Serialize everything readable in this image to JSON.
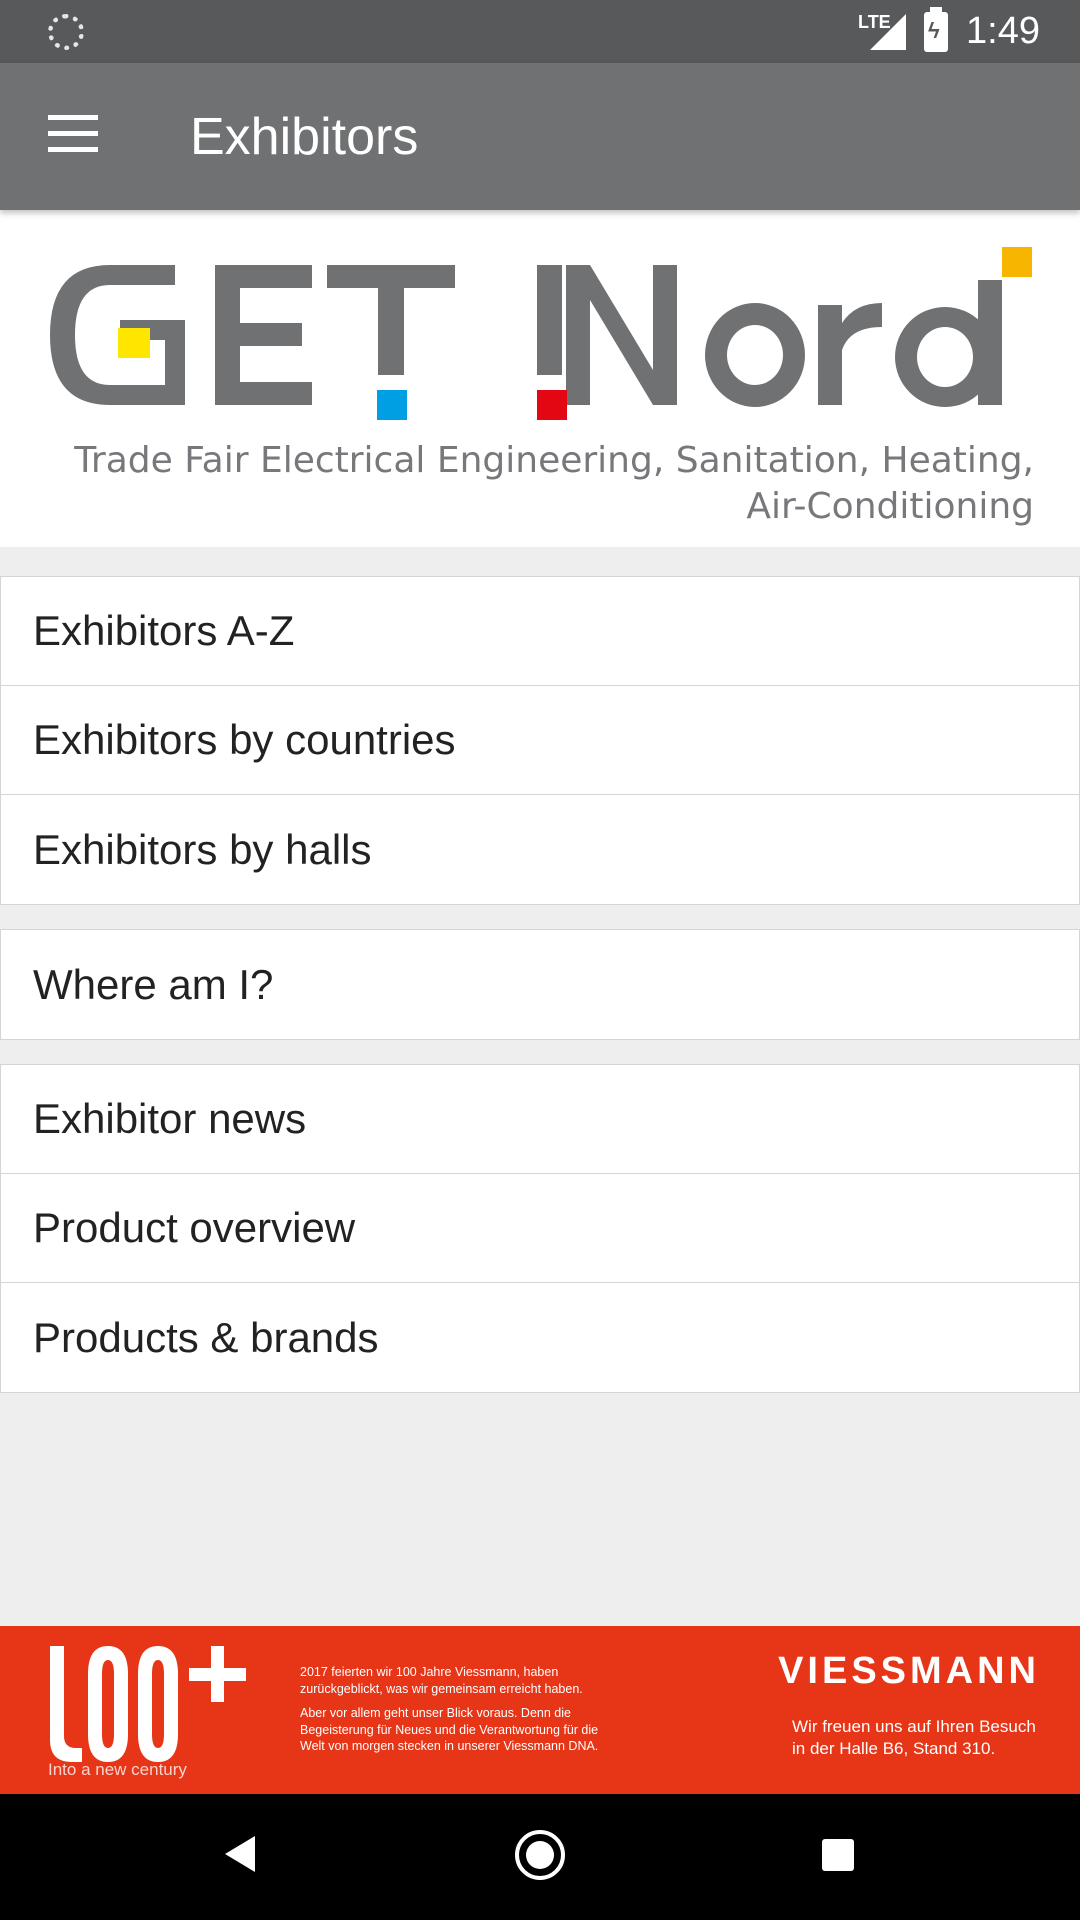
{
  "status_bar": {
    "network": "LTE",
    "time": "1:49"
  },
  "app_bar": {
    "title": "Exhibitors"
  },
  "logo": {
    "name": "GET Nord",
    "tagline_line1": "Trade Fair Electrical Engineering, Sanitation, Heating,",
    "tagline_line2": "Air-Conditioning",
    "colors": {
      "gray": "#707173",
      "yellow": "#ffe600",
      "blue": "#009fe3",
      "red": "#e30613",
      "orange": "#f7b500"
    }
  },
  "menu_groups": [
    {
      "items": [
        {
          "label": "Exhibitors A-Z"
        },
        {
          "label": "Exhibitors by countries"
        },
        {
          "label": "Exhibitors by halls"
        }
      ]
    },
    {
      "items": [
        {
          "label": "Where am I?"
        }
      ]
    },
    {
      "items": [
        {
          "label": "Exhibitor news"
        },
        {
          "label": "Product overview"
        },
        {
          "label": "Products & brands"
        }
      ]
    }
  ],
  "banner": {
    "century_text": "Into a new century",
    "paragraph1": "2017 feierten wir 100 Jahre Viessmann, haben zurückgeblickt, was wir gemeinsam erreicht haben.",
    "paragraph2": "Aber vor allem geht unser Blick voraus. Denn die Begeisterung für Neues und die Verantwortung für die Welt von morgen stecken in unserer Viessmann DNA.",
    "brand": "VIESSMANN",
    "visit_line1": "Wir freuen uns auf Ihren Besuch",
    "visit_line2": "in der Halle B6, Stand 310.",
    "background_color": "#e63517"
  }
}
